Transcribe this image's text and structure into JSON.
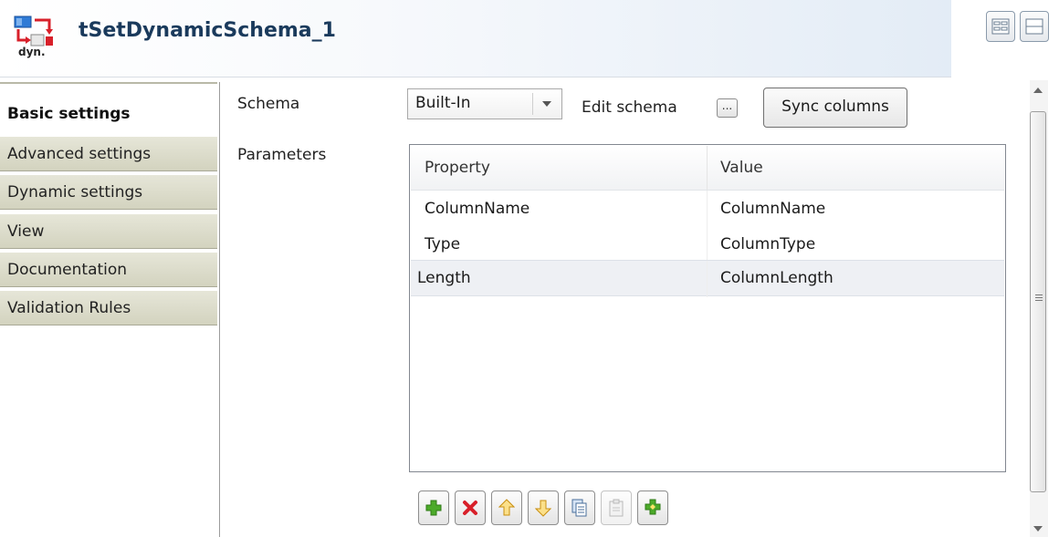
{
  "header": {
    "title": "tSetDynamicSchema_1",
    "icon_caption": "dyn.",
    "view_buttons": [
      "grid-view-icon",
      "list-view-icon"
    ]
  },
  "tabs": [
    {
      "label": "Basic settings",
      "active": true
    },
    {
      "label": "Advanced settings",
      "active": false
    },
    {
      "label": "Dynamic settings",
      "active": false
    },
    {
      "label": "View",
      "active": false
    },
    {
      "label": "Documentation",
      "active": false
    },
    {
      "label": "Validation Rules",
      "active": false
    }
  ],
  "form": {
    "schema_label": "Schema",
    "schema_value": "Built-In",
    "edit_schema_label": "Edit schema",
    "edit_schema_button": "...",
    "sync_columns_label": "Sync columns",
    "parameters_label": "Parameters"
  },
  "table": {
    "columns": [
      "Property",
      "Value"
    ],
    "rows": [
      {
        "property": "ColumnName",
        "value": "ColumnName"
      },
      {
        "property": "Type",
        "value": "ColumnType"
      },
      {
        "property": "Length",
        "value": "ColumnLength",
        "selected": true
      }
    ]
  },
  "toolbar": {
    "buttons": [
      {
        "icon": "add-icon",
        "enabled": true
      },
      {
        "icon": "remove-icon",
        "enabled": true
      },
      {
        "icon": "move-up-icon",
        "enabled": true
      },
      {
        "icon": "move-down-icon",
        "enabled": true
      },
      {
        "icon": "copy-icon",
        "enabled": true
      },
      {
        "icon": "paste-icon",
        "enabled": false
      },
      {
        "icon": "add-all-icon",
        "enabled": true
      }
    ]
  },
  "colors": {
    "tab_bg": "#d3d3bf",
    "title": "#1a3a5c",
    "add_green": "#4caa2a",
    "remove_red": "#d8202a",
    "arrow_yellow": "#f0b428"
  }
}
